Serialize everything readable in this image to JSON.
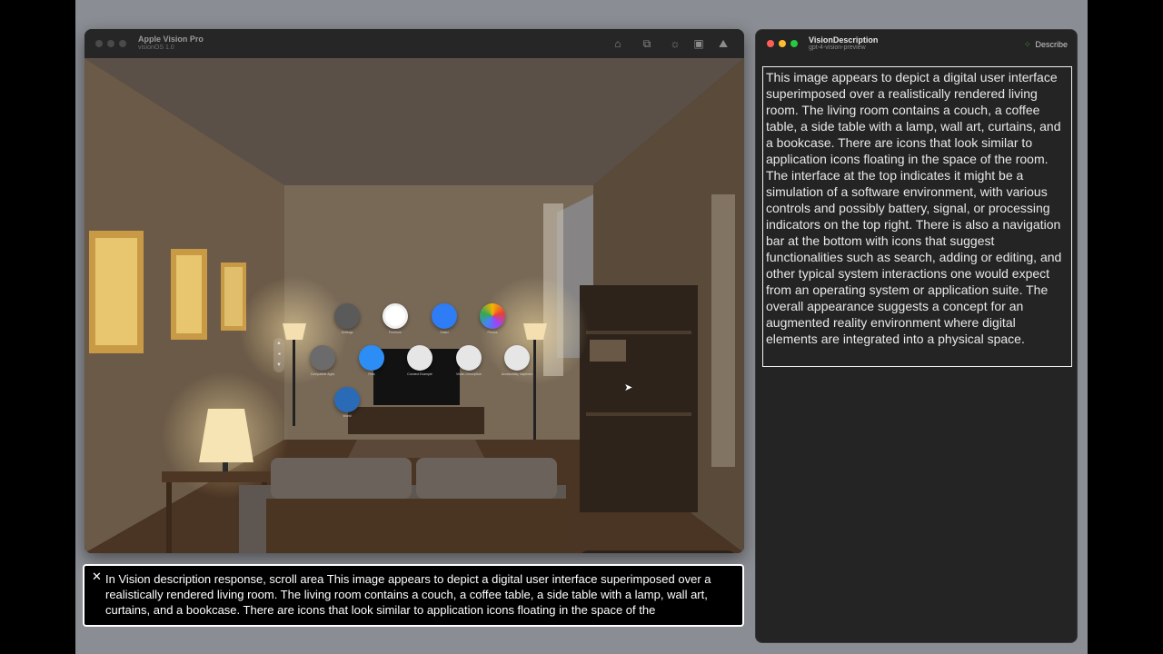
{
  "simulator": {
    "title": "Apple Vision Pro",
    "subtitle": "visionOS 1.0",
    "toolbar_icons": [
      "home-icon",
      "screenshot-icon",
      "brightness-icon",
      "device-icon",
      "environment-icon"
    ],
    "apps": [
      {
        "label": "Settings",
        "icon": "settings-icon",
        "color": "#5a5a5a"
      },
      {
        "label": "Freeform",
        "icon": "freeform-icon",
        "color": "#ffffff"
      },
      {
        "label": "Safari",
        "icon": "safari-icon",
        "color": "#2e7cf6"
      },
      {
        "label": "Photos",
        "icon": "photos-icon",
        "color": "#ffffff"
      },
      {
        "label": "Compatible Apps",
        "icon": "compatible-apps-icon",
        "color": "#6b6b6b"
      },
      {
        "label": "Files",
        "icon": "files-icon",
        "color": "#2c8ef5"
      },
      {
        "label": "Connect Example",
        "icon": "connect-example-icon",
        "color": "#e6e6e6"
      },
      {
        "label": "Vision Description",
        "icon": "vision-description-icon",
        "color": "#e6e6e6"
      },
      {
        "label": "Accessibility Inspector",
        "icon": "accessibility-inspector-icon",
        "color": "#e6e6e6"
      },
      {
        "label": "World",
        "icon": "globe-icon",
        "color": "#2a6bb8"
      }
    ],
    "bottom_tools": [
      "rotate-icon",
      "pan-icon",
      "move-icon",
      "orbit-icon",
      "zoom-icon",
      "record-icon"
    ]
  },
  "vision_window": {
    "title": "VisionDescription",
    "subtitle": "gpt-4-vision-preview",
    "describe_label": "Describe",
    "description": "This image appears to depict a digital user interface superimposed over a realistically rendered living room. The living room contains a couch, a coffee table, a side table with a lamp, wall art, curtains, and a bookcase. There are icons that look similar to application icons floating in the space of the room. The interface at the top indicates it might be a simulation of a software environment, with various controls and possibly battery, signal, or processing indicators on the top right. There is also a navigation bar at the bottom with icons that suggest functionalities such as search, adding or editing, and other typical system interactions one would expect from an operating system or application suite. The overall appearance suggests a concept for an augmented reality environment where digital elements are integrated into a physical space."
  },
  "caption": {
    "text": "In Vision description response, scroll area This image appears to depict a digital user interface superimposed over a realistically rendered living room. The living room contains a couch, a coffee table, a side table with a lamp, wall art, curtains, and a bookcase. There are icons that look similar to application icons floating in the space of the"
  }
}
